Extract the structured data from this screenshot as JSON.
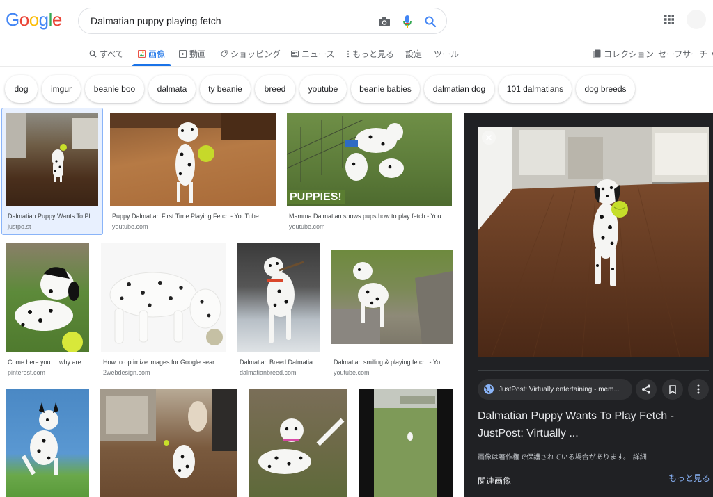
{
  "header": {
    "logo": "Google",
    "search_query": "Dalmatian puppy playing fetch"
  },
  "tabs": [
    {
      "label": "すべて",
      "icon": "search-icon"
    },
    {
      "label": "画像",
      "icon": "image-icon",
      "active": true
    },
    {
      "label": "動画",
      "icon": "video-icon"
    },
    {
      "label": "ショッピング",
      "icon": "tag-icon"
    },
    {
      "label": "ニュース",
      "icon": "news-icon"
    },
    {
      "label": "もっと見る",
      "icon": "more-vert-icon"
    },
    {
      "label": "設定"
    },
    {
      "label": "ツール"
    }
  ],
  "right_tools": {
    "collections": "コレクション",
    "safesearch": "セーフサーチ"
  },
  "chips": [
    "dog",
    "imgur",
    "beanie boo",
    "dalmata",
    "ty beanie",
    "breed",
    "youtube",
    "beanie babies",
    "dalmatian dog",
    "101 dalmatians",
    "dog breeds"
  ],
  "results": [
    {
      "title": "Dalmatian Puppy Wants To Pl...",
      "site": "justpo.st",
      "selected": true
    },
    {
      "title": "Puppy Dalmatian First Time Playing Fetch - YouTube",
      "site": "youtube.com"
    },
    {
      "title": "Mamma Dalmatian shows pups how to play fetch - You...",
      "site": "youtube.com",
      "overlay": "PUPPIES!"
    },
    {
      "title": "Come here you.....why are ...",
      "site": "pinterest.com"
    },
    {
      "title": "How to optimize images for Google sear...",
      "site": "2webdesign.com"
    },
    {
      "title": "Dalmatian Breed Dalmatia...",
      "site": "dalmatianbreed.com"
    },
    {
      "title": "Dalmatian smiling & playing fetch. - Yo...",
      "site": "youtube.com"
    }
  ],
  "panel": {
    "source": "JustPost: Virtually entertaining - mem...",
    "title": "Dalmatian Puppy Wants To Play Fetch - JustPost: Virtually ...",
    "copyright": "画像は著作権で保護されている場合があります。",
    "details": "詳細",
    "related": "関連画像",
    "more": "もっと見る"
  },
  "colors": {
    "accent": "#1a73e8",
    "panel_bg": "#202124",
    "link_blue": "#8ab4f8"
  }
}
